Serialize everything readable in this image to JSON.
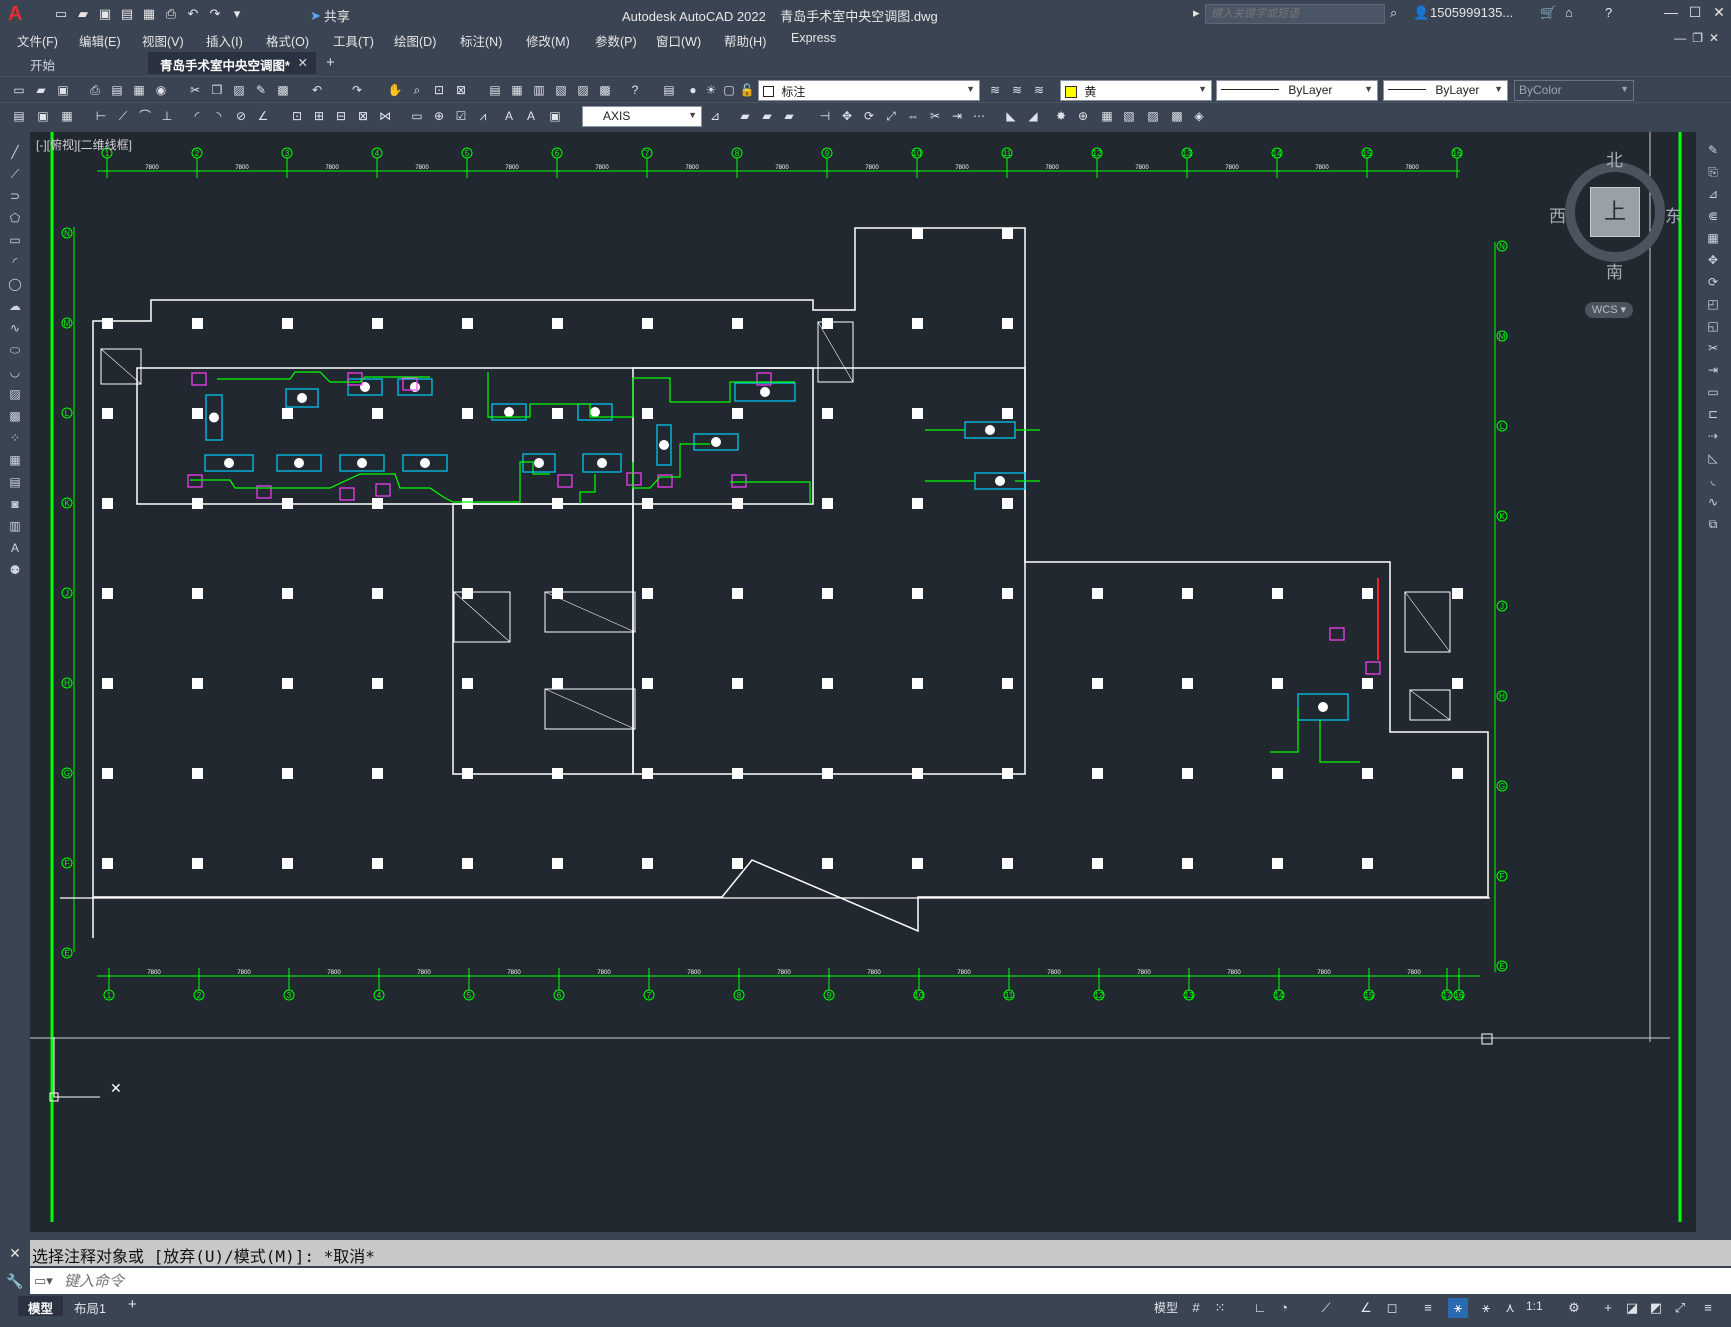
{
  "titlebar": {
    "logo": "A",
    "share_label": "共享",
    "title": "Autodesk AutoCAD 2022    青岛手术室中央空调图.dwg",
    "search_placeholder": "键入关键字或短语",
    "user": "1505999135...",
    "icons": [
      "new-icon",
      "open-icon",
      "save-icon",
      "saveas-icon",
      "publish-icon",
      "print-icon",
      "undo-icon",
      "redo-icon",
      "customize-icon"
    ]
  },
  "menubar": {
    "items": [
      "文件(F)",
      "编辑(E)",
      "视图(V)",
      "插入(I)",
      "格式(O)",
      "工具(T)",
      "绘图(D)",
      "标注(N)",
      "修改(M)",
      "参数(P)",
      "窗口(W)",
      "帮助(H)",
      "Express"
    ]
  },
  "tabs": {
    "start": "开始",
    "active": "青岛手术室中央空调图*"
  },
  "toolbar1": {
    "layer_name": "标注",
    "color_name": "黄",
    "color_hex": "#ffff00",
    "linetype": "ByLayer",
    "lineweight": "ByLayer",
    "plotstyle": "ByColor"
  },
  "toolbar2": {
    "dimstyle": "AXIS"
  },
  "viewport": {
    "label": "[-][俯视][二维线框]",
    "viewcube": {
      "north": "北",
      "south": "南",
      "east": "东",
      "west": "西",
      "face": "上"
    },
    "wcs": "WCS ▾"
  },
  "drawing": {
    "grid_numbers_top": [
      "1",
      "2",
      "3",
      "4",
      "5",
      "6",
      "7",
      "8",
      "9",
      "10",
      "11",
      "12",
      "13",
      "14",
      "15",
      "16"
    ],
    "grid_numbers_bottom": [
      "1",
      "2",
      "3",
      "4",
      "5",
      "6",
      "7",
      "8",
      "9",
      "10",
      "11",
      "12",
      "13",
      "14",
      "15",
      "16",
      "17"
    ],
    "grid_letters_left": [
      "N",
      "M",
      "L",
      "K",
      "J",
      "H",
      "G",
      "F",
      "E"
    ],
    "grid_letters_right": [
      "N",
      "M",
      "L",
      "K",
      "J",
      "H",
      "G",
      "F",
      "E"
    ],
    "spacing_label": "7800",
    "colors": {
      "background": "#212830",
      "walls": "#ffffff",
      "grid": "#00ff00",
      "ducts": "#00d0ff",
      "units": "#ff40ff",
      "riser": "#ff2020"
    }
  },
  "command": {
    "history": "选择注释对象或 [放弃(U)/模式(M)]: *取消*",
    "input_placeholder": "键入命令"
  },
  "statusbar": {
    "tab_model": "模型",
    "tab_layout": "布局1",
    "model_label": "模型",
    "scale": "1:1"
  }
}
